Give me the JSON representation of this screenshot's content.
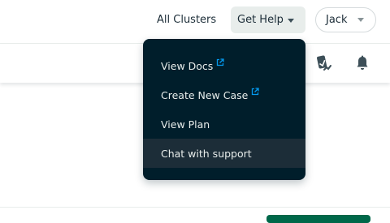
{
  "header": {
    "all_clusters": "All Clusters",
    "get_help": "Get Help",
    "user": "Jack"
  },
  "help_menu": {
    "items": [
      {
        "label": "View Docs",
        "external": true
      },
      {
        "label": "Create New Case",
        "external": true
      },
      {
        "label": "View Plan",
        "external": false
      },
      {
        "label": "Chat with support",
        "external": false,
        "highlighted": true
      }
    ]
  },
  "icons": {
    "toolbar": [
      "reports-icon",
      "bell-icon"
    ],
    "external": "external-link-icon"
  },
  "colors": {
    "menu_bg": "#001e2b",
    "menu_hover": "#1c2d38",
    "link_blue": "#0498ec",
    "primary_green": "#00684a"
  }
}
